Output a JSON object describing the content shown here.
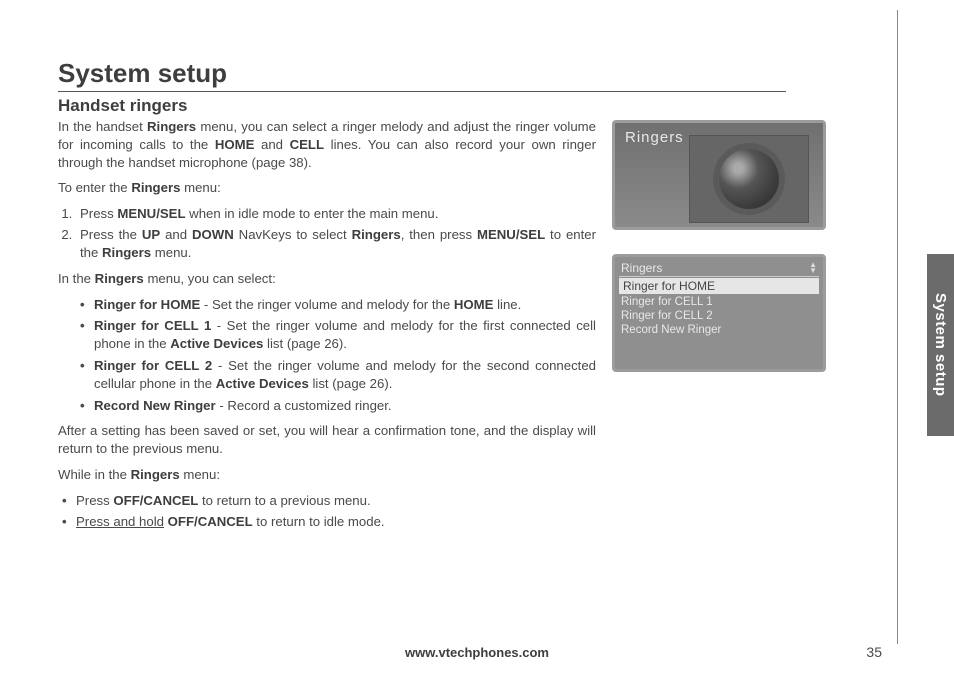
{
  "title": "System setup",
  "subtitle": "Handset ringers",
  "intro": {
    "p1a": "In the handset ",
    "p1b": "Ringers",
    "p1c": " menu, you can select a ringer melody and adjust the ringer volume for incoming calls to the ",
    "p1d": "HOME",
    "p1e": " and ",
    "p1f": "CELL",
    "p1g": " lines. You can also record your own ringer through the handset microphone (page 38)."
  },
  "enter": {
    "lead_a": "To enter the ",
    "lead_b": "Ringers",
    "lead_c": " menu:",
    "s1a": "Press ",
    "s1b": "MENU/SEL",
    "s1c": " when in idle mode to enter the main menu.",
    "s2a": "Press the ",
    "s2b": "UP",
    "s2c": " and ",
    "s2d": "DOWN",
    "s2e": " NavKeys to select ",
    "s2f": "Ringers",
    "s2g": ", then press ",
    "s2h": "MENU/SEL",
    "s2i": " to enter the ",
    "s2j": "Ringers",
    "s2k": " menu."
  },
  "inmenu": {
    "lead_a": "In the ",
    "lead_b": "Ringers",
    "lead_c": " menu, you can select:",
    "i1a": "Ringer for HOME",
    "i1b": " - Set the ringer volume and melody for the ",
    "i1c": "HOME",
    "i1d": " line.",
    "i2a": "Ringer for CELL 1",
    "i2b": " - Set the ringer volume and melody for the first connected cell phone in the ",
    "i2c": "Active Devices",
    "i2d": " list (page 26).",
    "i3a": "Ringer for CELL  2",
    "i3b": " - Set the ringer volume and melody for the second connected cellular phone in the ",
    "i3c": "Active Devices",
    "i3d": " list (page 26).",
    "i4a": "Record New Ringer",
    "i4b": " - Record a customized ringer."
  },
  "after": "After a setting has been saved or set, you will hear a confirmation tone, and the display will return to the previous menu.",
  "while": {
    "lead_a": "While in the ",
    "lead_b": "Ringers",
    "lead_c": " menu:",
    "w1a": "Press ",
    "w1b": "OFF/CANCEL",
    "w1c": " to return to a previous menu.",
    "w2a": "Press and hold",
    "w2b": " ",
    "w2c": "OFF/CANCEL",
    "w2d": " to return to idle mode."
  },
  "screen1_title": "Ringers",
  "screen2": {
    "header": "Ringers",
    "items": [
      "Ringer for HOME",
      "Ringer for CELL 1",
      "Ringer for CELL 2",
      "Record New Ringer"
    ]
  },
  "sidetab": "System setup",
  "footer": "www.vtechphones.com",
  "pagenum": "35"
}
